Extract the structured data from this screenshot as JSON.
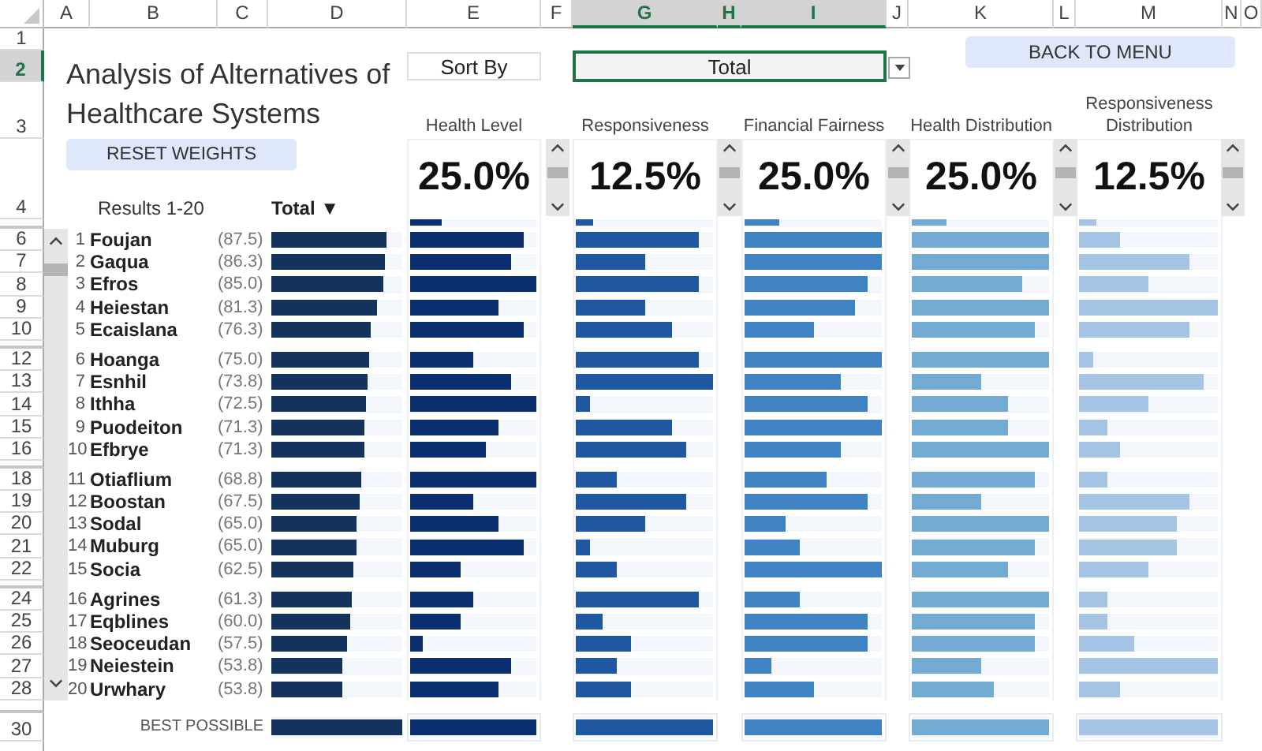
{
  "column_headers": [
    {
      "label": "A",
      "selected": false
    },
    {
      "label": "B",
      "selected": false
    },
    {
      "label": "C",
      "selected": false
    },
    {
      "label": "D",
      "selected": false
    },
    {
      "label": "E",
      "selected": false
    },
    {
      "label": "F",
      "selected": false
    },
    {
      "label": "G",
      "selected": true
    },
    {
      "label": "H",
      "selected": true
    },
    {
      "label": "I",
      "selected": true
    },
    {
      "label": "J",
      "selected": false
    },
    {
      "label": "K",
      "selected": false
    },
    {
      "label": "L",
      "selected": false
    },
    {
      "label": "M",
      "selected": false
    },
    {
      "label": "N",
      "selected": false
    },
    {
      "label": "O",
      "selected": false
    }
  ],
  "row_headers": [
    {
      "label": "1",
      "selected": false
    },
    {
      "label": "2",
      "selected": true
    },
    {
      "label": "3",
      "selected": false
    },
    {
      "label": "4",
      "selected": false
    },
    {
      "label": "6",
      "selected": false
    },
    {
      "label": "7",
      "selected": false
    },
    {
      "label": "8",
      "selected": false
    },
    {
      "label": "9",
      "selected": false
    },
    {
      "label": "10",
      "selected": false
    },
    {
      "label": "12",
      "selected": false
    },
    {
      "label": "13",
      "selected": false
    },
    {
      "label": "14",
      "selected": false
    },
    {
      "label": "15",
      "selected": false
    },
    {
      "label": "16",
      "selected": false
    },
    {
      "label": "18",
      "selected": false
    },
    {
      "label": "19",
      "selected": false
    },
    {
      "label": "20",
      "selected": false
    },
    {
      "label": "21",
      "selected": false
    },
    {
      "label": "22",
      "selected": false
    },
    {
      "label": "24",
      "selected": false
    },
    {
      "label": "25",
      "selected": false
    },
    {
      "label": "26",
      "selected": false
    },
    {
      "label": "27",
      "selected": false
    },
    {
      "label": "28",
      "selected": false
    },
    {
      "label": "30",
      "selected": false
    }
  ],
  "title": "Analysis of Alternatives of Healthcare Systems",
  "sort_by": {
    "label": "Sort By",
    "value": "Total"
  },
  "back_button": "BACK TO MENU",
  "reset_button": "RESET WEIGHTS",
  "results_label": "Results 1-20",
  "total_header": "Total ▼",
  "criteria": [
    {
      "name": "Health Level",
      "weight": "25.0%",
      "level": 0.25,
      "color": "#0b2e6e"
    },
    {
      "name": "Responsiveness",
      "weight": "12.5%",
      "level": 0.125,
      "color": "#1f58a0"
    },
    {
      "name": "Financial Fairness",
      "weight": "25.0%",
      "level": 0.25,
      "color": "#4083c3"
    },
    {
      "name": "Health Distribution",
      "weight": "25.0%",
      "level": 0.25,
      "color": "#74abd3"
    },
    {
      "name": "Responsiveness Distribution",
      "weight": "12.5%",
      "level": 0.125,
      "color": "#a6c5e5"
    }
  ],
  "results": [
    {
      "rank": "1",
      "name": "Foujan",
      "score": "(87.5)",
      "level": 0.875,
      "bars": [
        {
          "level": 0.9
        },
        {
          "level": 0.9
        },
        {
          "level": 1
        },
        {
          "level": 1
        },
        {
          "level": 0.3
        }
      ]
    },
    {
      "rank": "2",
      "name": "Gaqua",
      "score": "(86.3)",
      "level": 0.863,
      "bars": [
        {
          "level": 0.8
        },
        {
          "level": 0.5
        },
        {
          "level": 1
        },
        {
          "level": 1
        },
        {
          "level": 0.8
        }
      ]
    },
    {
      "rank": "3",
      "name": "Efros",
      "score": "(85.0)",
      "level": 0.85,
      "bars": [
        {
          "level": 1
        },
        {
          "level": 0.9
        },
        {
          "level": 0.9
        },
        {
          "level": 0.8
        },
        {
          "level": 0.5
        }
      ]
    },
    {
      "rank": "4",
      "name": "Heiestan",
      "score": "(81.3)",
      "level": 0.813,
      "bars": [
        {
          "level": 0.7
        },
        {
          "level": 0.5
        },
        {
          "level": 0.8
        },
        {
          "level": 1
        },
        {
          "level": 1
        }
      ]
    },
    {
      "rank": "5",
      "name": "Ecaislana",
      "score": "(76.3)",
      "level": 0.763,
      "bars": [
        {
          "level": 0.9
        },
        {
          "level": 0.7
        },
        {
          "level": 0.5
        },
        {
          "level": 0.9
        },
        {
          "level": 0.8
        }
      ]
    },
    {
      "rank": "6",
      "name": "Hoanga",
      "score": "(75.0)",
      "level": 0.75,
      "bars": [
        {
          "level": 0.5
        },
        {
          "level": 0.9
        },
        {
          "level": 1
        },
        {
          "level": 1
        },
        {
          "level": 0.1
        }
      ]
    },
    {
      "rank": "7",
      "name": "Esnhil",
      "score": "(73.8)",
      "level": 0.738,
      "bars": [
        {
          "level": 0.8
        },
        {
          "level": 1
        },
        {
          "level": 0.7
        },
        {
          "level": 0.5
        },
        {
          "level": 0.9
        }
      ]
    },
    {
      "rank": "8",
      "name": "Ithha",
      "score": "(72.5)",
      "level": 0.725,
      "bars": [
        {
          "level": 1
        },
        {
          "level": 0.1
        },
        {
          "level": 0.9
        },
        {
          "level": 0.7
        },
        {
          "level": 0.5
        }
      ]
    },
    {
      "rank": "9",
      "name": "Puodeiton",
      "score": "(71.3)",
      "level": 0.713,
      "bars": [
        {
          "level": 0.7
        },
        {
          "level": 0.7
        },
        {
          "level": 1
        },
        {
          "level": 0.7
        },
        {
          "level": 0.2
        }
      ]
    },
    {
      "rank": "10",
      "name": "Efbrye",
      "score": "(71.3)",
      "level": 0.713,
      "bars": [
        {
          "level": 0.6
        },
        {
          "level": 0.8
        },
        {
          "level": 0.7
        },
        {
          "level": 1
        },
        {
          "level": 0.3
        }
      ]
    },
    {
      "rank": "11",
      "name": "Otiaflium",
      "score": "(68.8)",
      "level": 0.688,
      "bars": [
        {
          "level": 1
        },
        {
          "level": 0.3
        },
        {
          "level": 0.6
        },
        {
          "level": 0.9
        },
        {
          "level": 0.2
        }
      ]
    },
    {
      "rank": "12",
      "name": "Boostan",
      "score": "(67.5)",
      "level": 0.675,
      "bars": [
        {
          "level": 0.5
        },
        {
          "level": 0.8
        },
        {
          "level": 0.9
        },
        {
          "level": 0.5
        },
        {
          "level": 0.8
        }
      ]
    },
    {
      "rank": "13",
      "name": "Sodal",
      "score": "(65.0)",
      "level": 0.65,
      "bars": [
        {
          "level": 0.7
        },
        {
          "level": 0.5
        },
        {
          "level": 0.3
        },
        {
          "level": 1
        },
        {
          "level": 0.7
        }
      ]
    },
    {
      "rank": "14",
      "name": "Muburg",
      "score": "(65.0)",
      "level": 0.65,
      "bars": [
        {
          "level": 0.9
        },
        {
          "level": 0.1
        },
        {
          "level": 0.4
        },
        {
          "level": 0.9
        },
        {
          "level": 0.7
        }
      ]
    },
    {
      "rank": "15",
      "name": "Socia",
      "score": "(62.5)",
      "level": 0.625,
      "bars": [
        {
          "level": 0.4
        },
        {
          "level": 0.3
        },
        {
          "level": 1
        },
        {
          "level": 0.7
        },
        {
          "level": 0.5
        }
      ]
    },
    {
      "rank": "16",
      "name": "Agrines",
      "score": "(61.3)",
      "level": 0.613,
      "bars": [
        {
          "level": 0.5
        },
        {
          "level": 0.9
        },
        {
          "level": 0.4
        },
        {
          "level": 1
        },
        {
          "level": 0.2
        }
      ]
    },
    {
      "rank": "17",
      "name": "Eqblines",
      "score": "(60.0)",
      "level": 0.6,
      "bars": [
        {
          "level": 0.4
        },
        {
          "level": 0.2
        },
        {
          "level": 0.9
        },
        {
          "level": 0.9
        },
        {
          "level": 0.2
        }
      ]
    },
    {
      "rank": "18",
      "name": "Seoceudan",
      "score": "(57.5)",
      "level": 0.575,
      "bars": [
        {
          "level": 0.1
        },
        {
          "level": 0.4
        },
        {
          "level": 0.9
        },
        {
          "level": 0.9
        },
        {
          "level": 0.4
        }
      ]
    },
    {
      "rank": "19",
      "name": "Neiestein",
      "score": "(53.8)",
      "level": 0.538,
      "bars": [
        {
          "level": 0.8
        },
        {
          "level": 0.3
        },
        {
          "level": 0.2
        },
        {
          "level": 0.5
        },
        {
          "level": 1
        }
      ]
    },
    {
      "rank": "20",
      "name": "Urwhary",
      "score": "(53.8)",
      "level": 0.538,
      "bars": [
        {
          "level": 0.7
        },
        {
          "level": 0.4
        },
        {
          "level": 0.5
        },
        {
          "level": 0.6
        },
        {
          "level": 0.3
        }
      ]
    }
  ],
  "best_possible": {
    "label": "BEST POSSIBLE",
    "level": 1,
    "bars": [
      {
        "level": 1
      },
      {
        "level": 1
      },
      {
        "level": 1
      },
      {
        "level": 1
      },
      {
        "level": 1
      }
    ]
  }
}
